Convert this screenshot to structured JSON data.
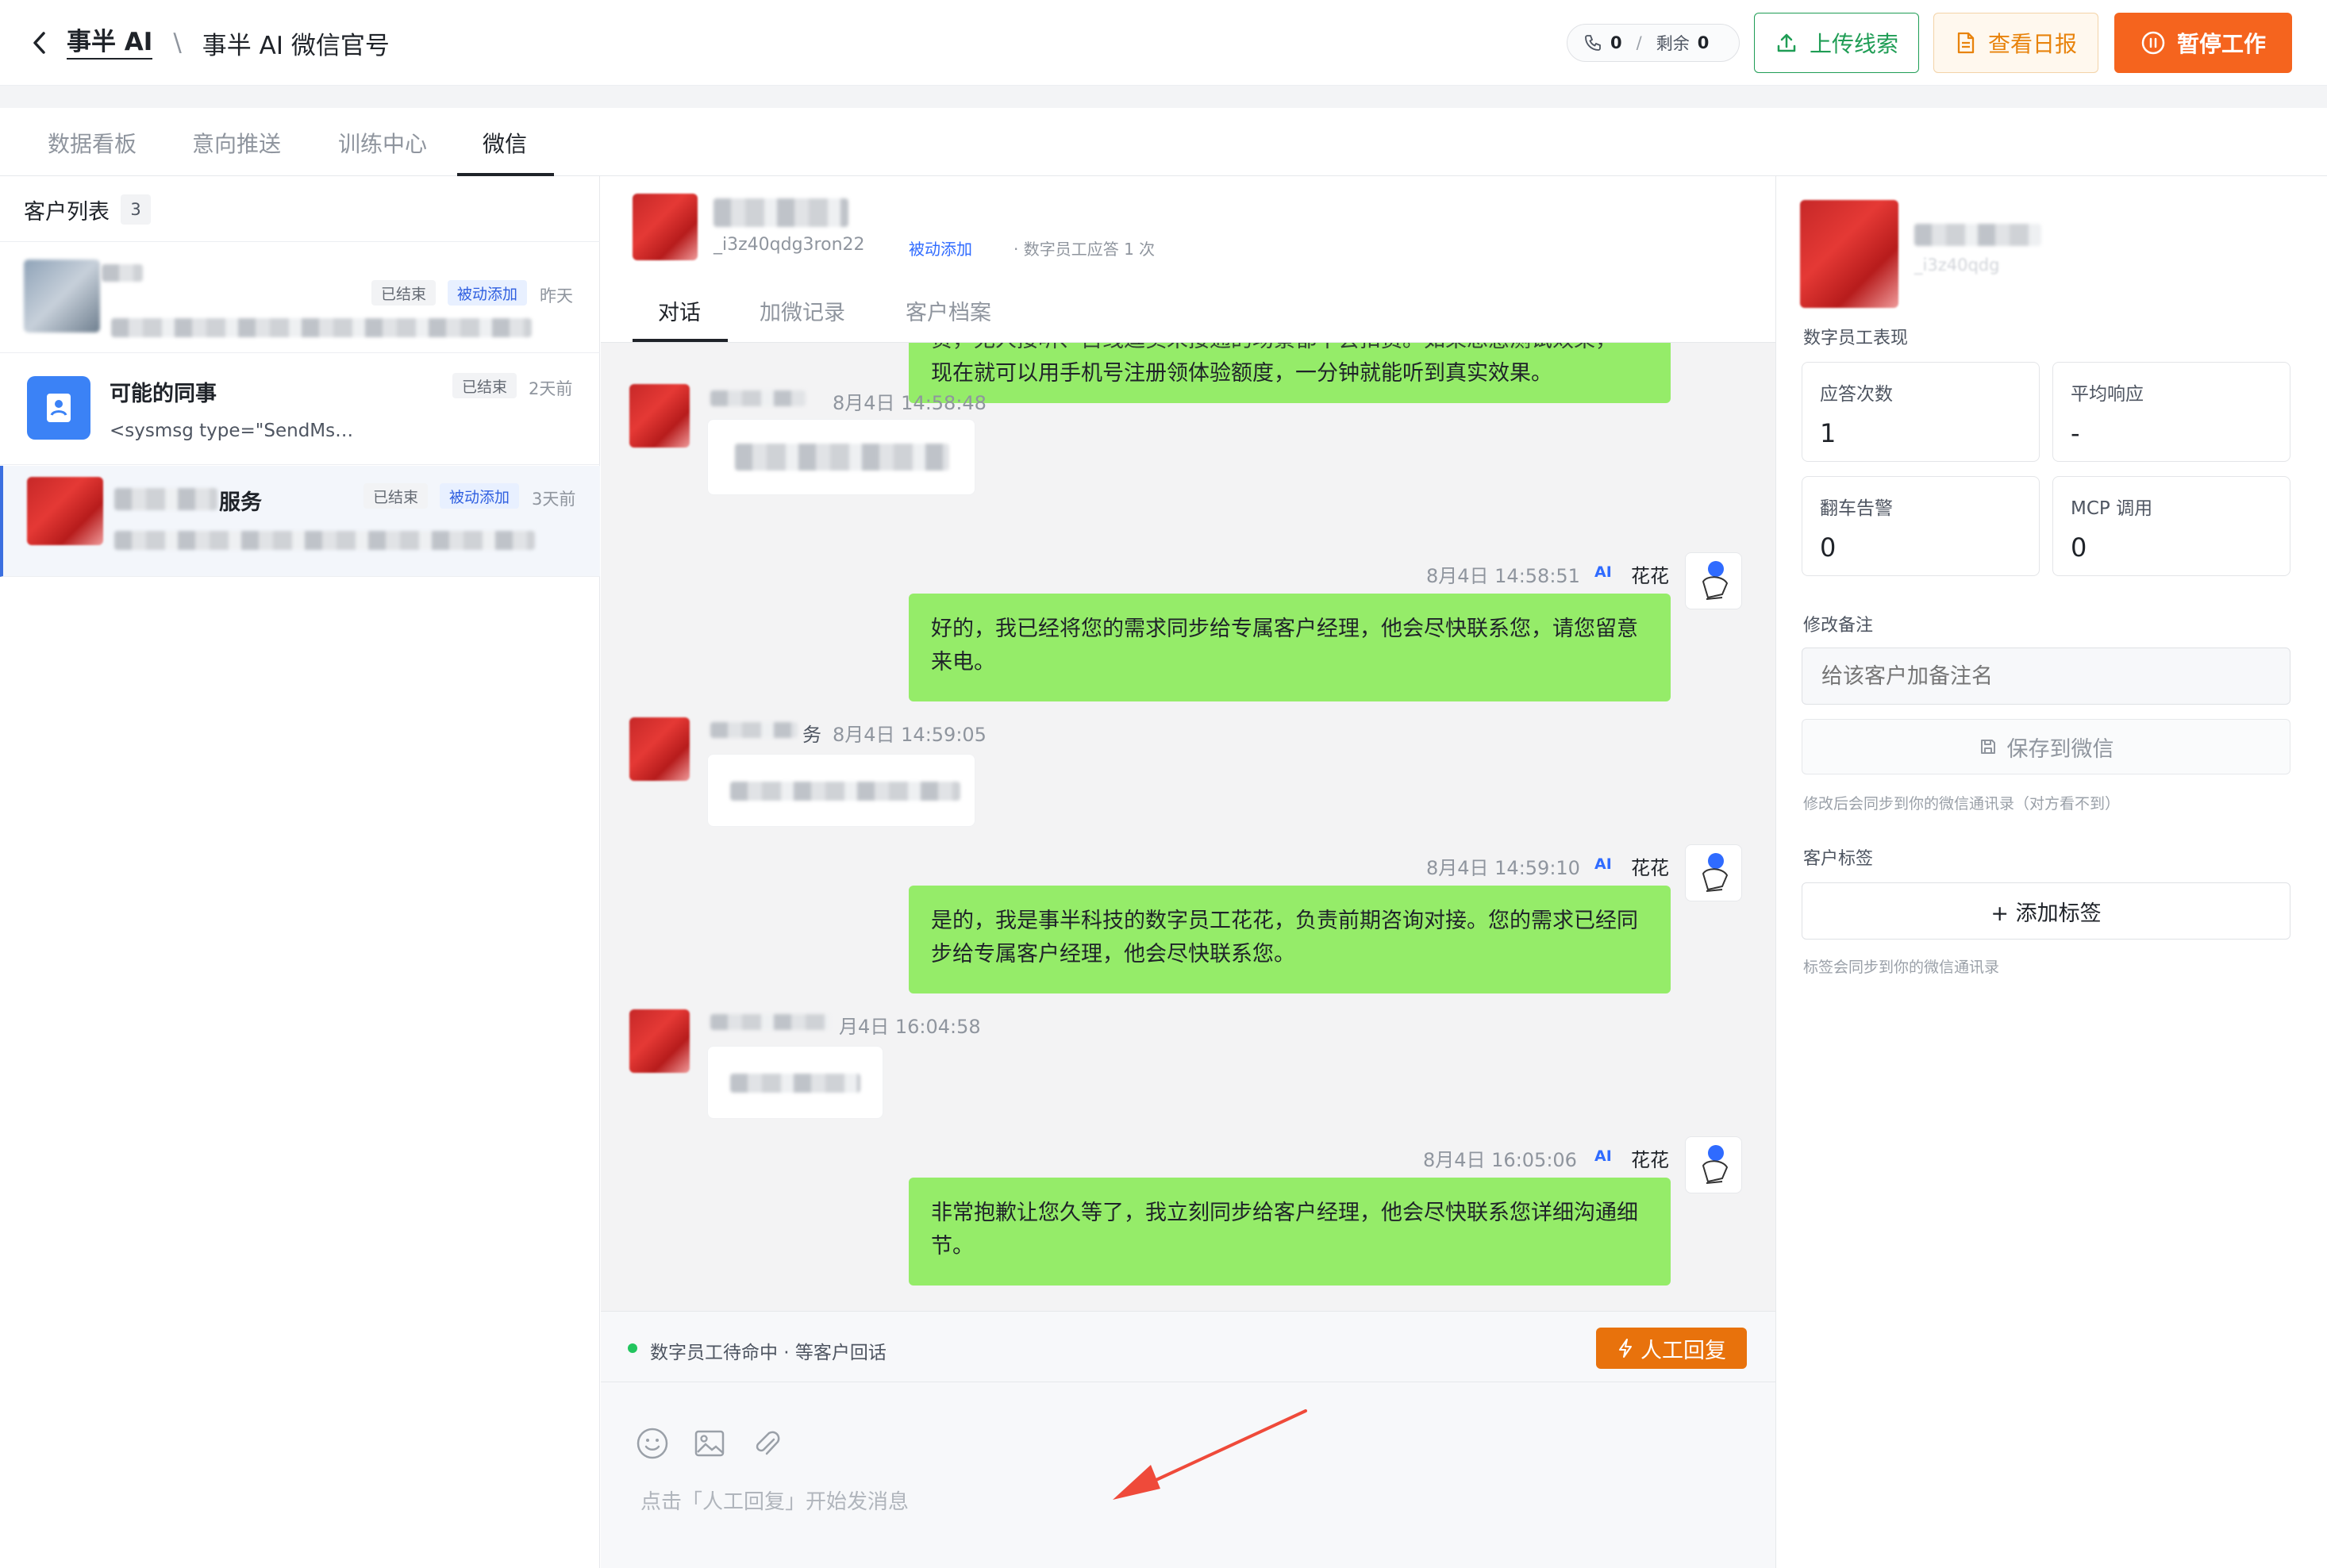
{
  "header": {
    "back_label": "事半 AI",
    "separator": "\\",
    "title": "事半 AI 微信官号",
    "calls_count": "0",
    "calls_sep": "/",
    "remaining_label": "剩余",
    "remaining_count": "0",
    "upload_label": "上传线索",
    "report_label": "查看日报",
    "pause_label": "暂停工作"
  },
  "tabs": [
    "数据看板",
    "意向推送",
    "训练中心",
    "微信"
  ],
  "customer_list": {
    "title": "客户列表",
    "count": "3",
    "items": [
      {
        "name": "",
        "status": "已结束",
        "source": "被动添加",
        "time": "昨天",
        "preview": "…"
      },
      {
        "name": "可能的同事",
        "status": "已结束",
        "source": "",
        "time": "2天前",
        "preview": "<sysmsg type=\"SendMs…"
      },
      {
        "name": "服务",
        "status": "已结束",
        "source": "被动添加",
        "time": "3天前",
        "preview": "…"
      }
    ]
  },
  "chat": {
    "contact_id": "_i3z40qdg3ron22",
    "source": "被动添加",
    "stats": "· 数字员工应答 1 次",
    "subtabs": [
      "对话",
      "加微记录",
      "客户档案"
    ],
    "partial_top_line": "贵，无人接听、占线逗卖未接通的场景都不会扣费。如果想感测试效果，",
    "msg1_line2": "现在就可以用手机号注册领体验额度，一分钟就能听到真实效果。",
    "in1_time": "8月4日 14:58:48",
    "out1_time": "8月4日 14:58:51",
    "ai": "AI",
    "bot_name": "花花",
    "out1_text": "好的，我已经将您的需求同步给专属客户经理，他会尽快联系您，请您留意来电。",
    "in2_name_suffix": "务",
    "in2_time": "8月4日 14:59:05",
    "out2_time": "8月4日 14:59:10",
    "out2_text": "是的，我是事半科技的数字员工花花，负责前期咨询对接。您的需求已经同步给专属客户经理，他会尽快联系您。",
    "in3_time": "月4日 16:04:58",
    "out3_time": "8月4日 16:05:06",
    "out3_text": "非常抱歉让您久等了，我立刻同步给客户经理，他会尽快联系您详细沟通细节。",
    "status_text": "数字员工待命中 · 等客户回话",
    "manual_reply": "人工回复",
    "input_placeholder": "点击「人工回复」开始发消息"
  },
  "side": {
    "contact_id": "_i3z40qdg",
    "perf_title": "数字员工表现",
    "cards": [
      {
        "label": "应答次数",
        "value": "1"
      },
      {
        "label": "平均响应",
        "value": "-"
      },
      {
        "label": "翻车告警",
        "value": "0"
      },
      {
        "label": "MCP 调用",
        "value": "0"
      }
    ],
    "remark_title": "修改备注",
    "remark_placeholder": "给该客户加备注名",
    "save_label": "保存到微信",
    "remark_hint": "修改后会同步到你的微信通讯录（对方看不到）",
    "tag_title": "客户标签",
    "add_tag": "+ 添加标签",
    "tag_hint": "标签会同步到你的微信通讯录"
  },
  "colors": {
    "accent_orange": "#f5641e",
    "bubble_green": "#95ec69",
    "link_blue": "#2f6bff",
    "upload_green": "#1f9d55",
    "report_orange": "#e8830c",
    "annotation_red": "#ef4a3a"
  }
}
